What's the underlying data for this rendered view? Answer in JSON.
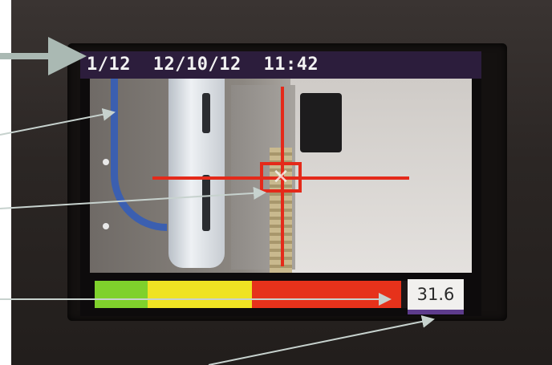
{
  "status_bar": {
    "image_counter": "1/12",
    "date": "12/10/12",
    "time": "11:42"
  },
  "gauge": {
    "reading": "31.6",
    "segments": [
      "green",
      "yellow",
      "red"
    ]
  },
  "colors": {
    "crosshair": "#e42a1a",
    "gauge_green": "#7fd12c",
    "gauge_yellow": "#efe323",
    "gauge_red": "#e6321b",
    "status_bar_bg": "#2c1d3c",
    "annotation_arrow": "#b9c7c2"
  },
  "icons": {
    "crosshair": "crosshair-icon",
    "target": "target-box-icon"
  }
}
